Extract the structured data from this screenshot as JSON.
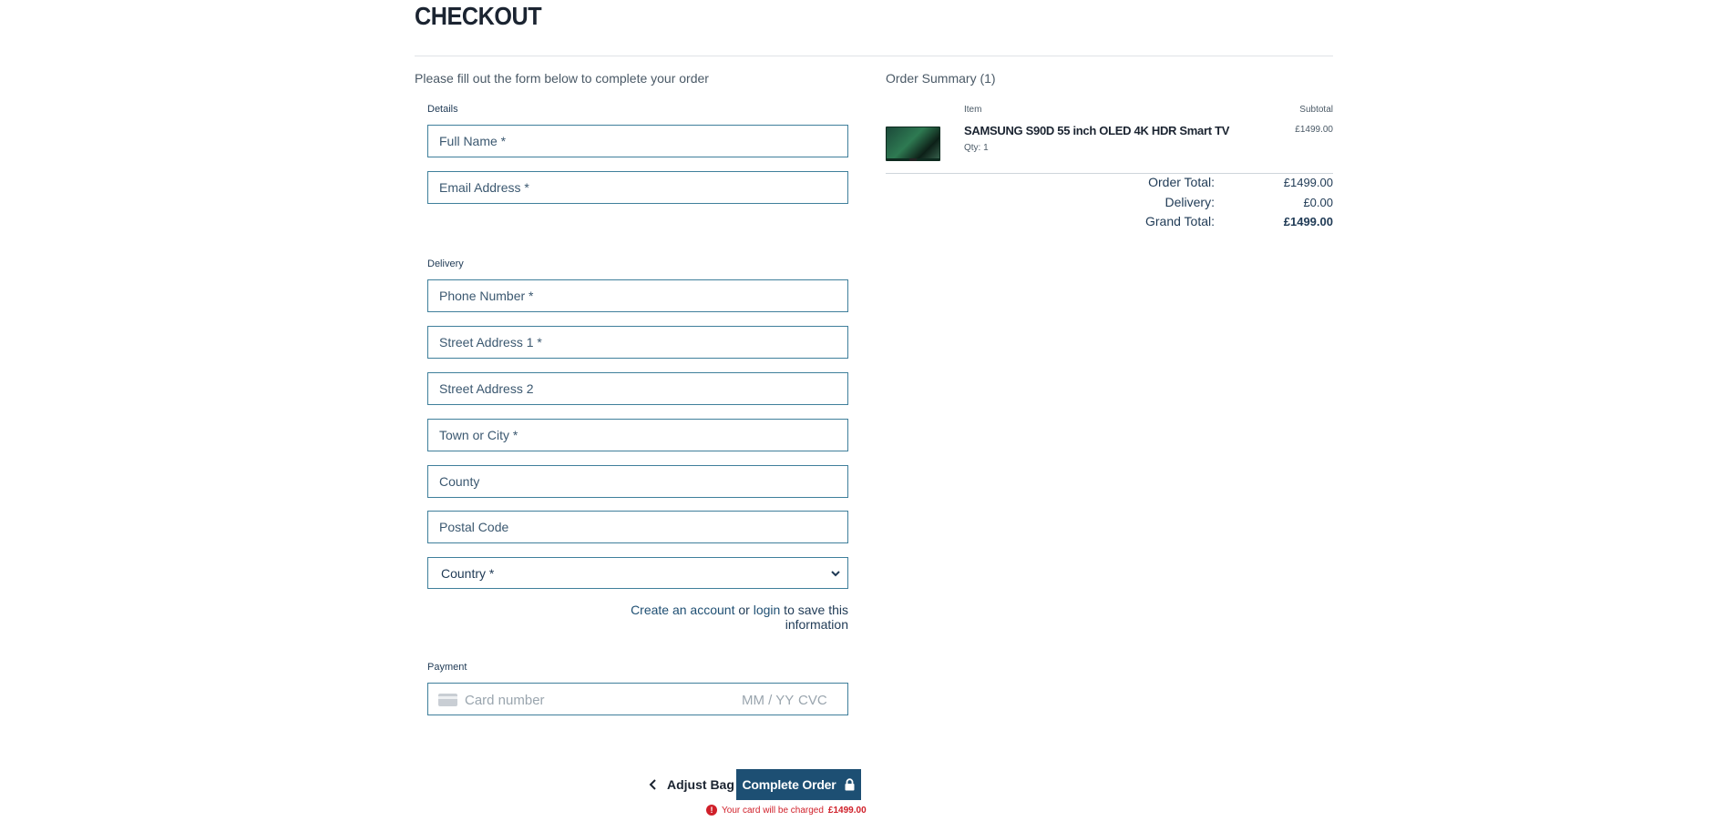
{
  "header": {
    "title": "CHECKOUT"
  },
  "form": {
    "intro": "Please fill out the form below to complete your order",
    "details_label": "Details",
    "full_name_placeholder": "Full Name *",
    "email_placeholder": "Email Address *",
    "delivery_label": "Delivery",
    "phone_placeholder": "Phone Number *",
    "street1_placeholder": "Street Address 1 *",
    "street2_placeholder": "Street Address 2",
    "town_placeholder": "Town or City *",
    "county_placeholder": "County",
    "postal_placeholder": "Postal Code",
    "country_selected": "Country *",
    "account_create": "Create an account",
    "account_or": " or ",
    "account_login": "login",
    "account_suffix": " to save this information",
    "payment_label": "Payment",
    "card_number_placeholder": "Card number",
    "card_expiry_placeholder": "MM / YY",
    "card_cvc_placeholder": "CVC"
  },
  "actions": {
    "adjust_bag": "Adjust Bag",
    "complete_order": "Complete Order",
    "charge_note_prefix": "Your card will be charged",
    "charge_amount": "£1499.00"
  },
  "summary": {
    "title": "Order Summary (1)",
    "col_item": "Item",
    "col_subtotal": "Subtotal",
    "items": [
      {
        "name": "SAMSUNG S90D 55 inch OLED 4K HDR Smart TV",
        "qty": "Qty: 1",
        "price": "£1499.00"
      }
    ],
    "order_total_label": "Order Total:",
    "order_total": "£1499.00",
    "delivery_label": "Delivery:",
    "delivery": "£0.00",
    "grand_total_label": "Grand Total:",
    "grand_total": "£1499.00"
  },
  "icons": {
    "back": "chevron-left-icon",
    "lock": "lock-icon",
    "alert": "alert-circle-icon",
    "card": "credit-card-icon",
    "dropdown": "chevron-down-icon"
  },
  "colors": {
    "accent": "#1d4f73",
    "field_border": "#3f7f9b",
    "error": "#d0202a"
  }
}
